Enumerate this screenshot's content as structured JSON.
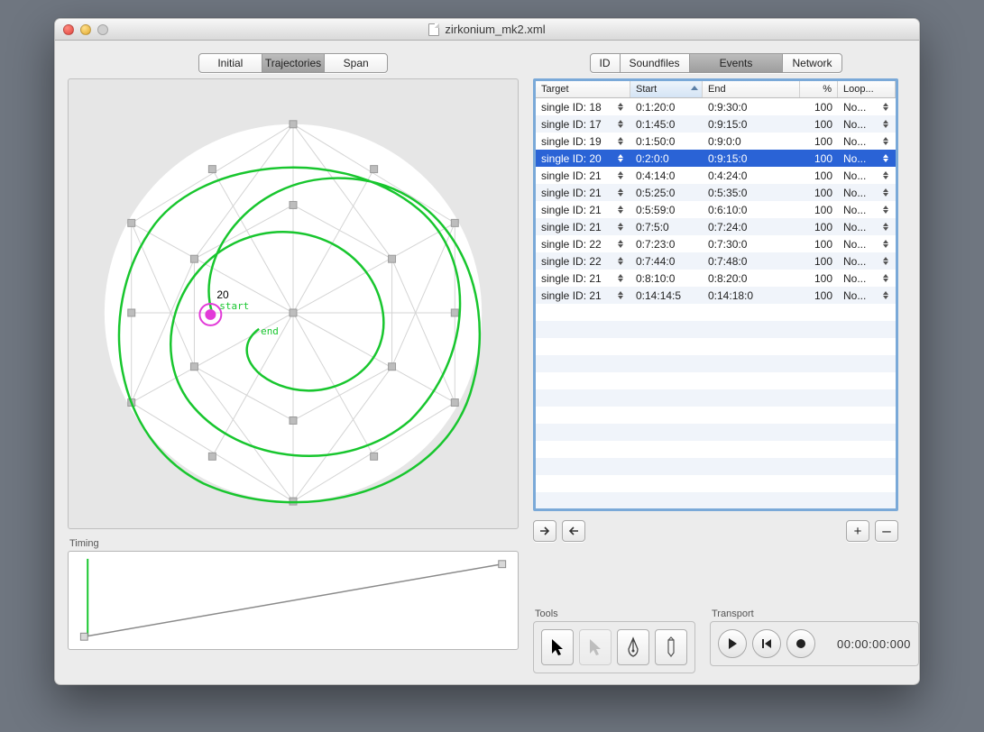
{
  "window": {
    "title": "zirkonium_mk2.xml"
  },
  "left_tabs": {
    "initial": "Initial",
    "trajectories": "Trajectories",
    "span": "Span",
    "active": "trajectories"
  },
  "canvas": {
    "point_id": "20",
    "start_label": "start",
    "end_label": "end"
  },
  "timing": {
    "label": "Timing"
  },
  "right_tabs": {
    "id": "ID",
    "soundfiles": "Soundfiles",
    "events": "Events",
    "network": "Network",
    "active": "events"
  },
  "table": {
    "headers": {
      "target": "Target",
      "start": "Start",
      "end": "End",
      "pct": "%",
      "loop": "Loop..."
    },
    "selected_index": 3,
    "rows": [
      {
        "target": "single ID: 18",
        "start": "0:1:20:0",
        "end": "0:9:30:0",
        "pct": "100",
        "loop": "No..."
      },
      {
        "target": "single ID: 17",
        "start": "0:1:45:0",
        "end": "0:9:15:0",
        "pct": "100",
        "loop": "No..."
      },
      {
        "target": "single ID: 19",
        "start": "0:1:50:0",
        "end": "0:9:0:0",
        "pct": "100",
        "loop": "No..."
      },
      {
        "target": "single ID: 20",
        "start": "0:2:0:0",
        "end": "0:9:15:0",
        "pct": "100",
        "loop": "No..."
      },
      {
        "target": "single ID: 21",
        "start": "0:4:14:0",
        "end": "0:4:24:0",
        "pct": "100",
        "loop": "No..."
      },
      {
        "target": "single ID: 21",
        "start": "0:5:25:0",
        "end": "0:5:35:0",
        "pct": "100",
        "loop": "No..."
      },
      {
        "target": "single ID: 21",
        "start": "0:5:59:0",
        "end": "0:6:10:0",
        "pct": "100",
        "loop": "No..."
      },
      {
        "target": "single ID: 21",
        "start": "0:7:5:0",
        "end": "0:7:24:0",
        "pct": "100",
        "loop": "No..."
      },
      {
        "target": "single ID: 22",
        "start": "0:7:23:0",
        "end": "0:7:30:0",
        "pct": "100",
        "loop": "No..."
      },
      {
        "target": "single ID: 22",
        "start": "0:7:44:0",
        "end": "0:7:48:0",
        "pct": "100",
        "loop": "No..."
      },
      {
        "target": "single ID: 21",
        "start": "0:8:10:0",
        "end": "0:8:20:0",
        "pct": "100",
        "loop": "No..."
      },
      {
        "target": "single ID: 21",
        "start": "0:14:14:5",
        "end": "0:14:18:0",
        "pct": "100",
        "loop": "No..."
      }
    ]
  },
  "buttons": {
    "plus": "+",
    "minus": "–"
  },
  "tools": {
    "label": "Tools"
  },
  "transport": {
    "label": "Transport",
    "time": "00:00:00:000"
  }
}
